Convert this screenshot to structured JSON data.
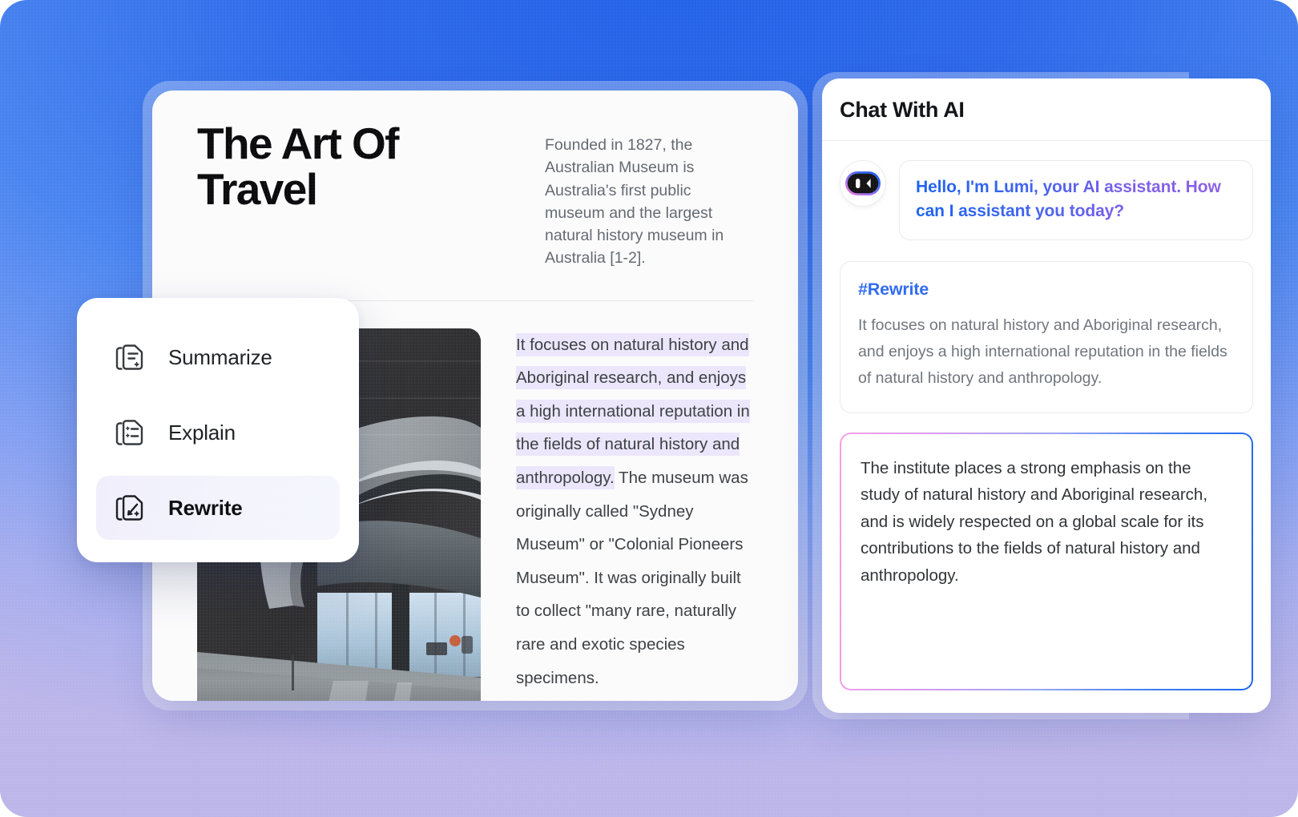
{
  "background": {
    "gradient_from": "#2463e8",
    "gradient_mid": "#4b86f0",
    "gradient_to": "#bdb6e9"
  },
  "document": {
    "title": "The Art  Of Travel",
    "intro": "Founded in 1827, the Australian Museum is Australia's first public museum and the largest natural history museum in Australia [1-2].",
    "photo_alt": "museum-interior-photo",
    "body_highlighted": "It focuses on natural history and Aboriginal research, and enjoys a high international reputation in the fields of natural history and anthropology.",
    "body_rest": " The museum was originally called \"Sydney Museum\" or \"Colonial Pioneers Museum\". It was originally built to collect \"many rare, naturally rare and exotic species specimens.",
    "highlight_color": "#ebe6fb"
  },
  "menu": {
    "items": [
      {
        "label": "Summarize",
        "icon": "document-lines-sparkle-icon",
        "active": false
      },
      {
        "label": "Explain",
        "icon": "document-bullet-list-icon",
        "active": false
      },
      {
        "label": "Rewrite",
        "icon": "document-pencil-sparkle-icon",
        "active": true
      }
    ]
  },
  "chat": {
    "title": "Chat With AI",
    "avatar_icon": "lumi-assistant-avatar-icon",
    "greeting": "Hello, I'm Lumi, your AI assistant. How can I assistant you today?",
    "greeting_gradient_from": "#1a63ef",
    "greeting_gradient_to": "#8f5fe6",
    "rewrite_card": {
      "tag": "#Rewrite",
      "tag_color": "#2f6bf0",
      "text": "It focuses on natural history and Aboriginal research, and enjoys a high international reputation in the fields of natural history and anthropology."
    },
    "result_card": {
      "text": "The institute places a strong emphasis on the study of natural history and Aboriginal research, and is widely respected on a global scale for its contributions to the fields of natural history and anthropology.",
      "border_gradient_from": "#f49fe4",
      "border_gradient_to": "#1a66ef"
    }
  }
}
